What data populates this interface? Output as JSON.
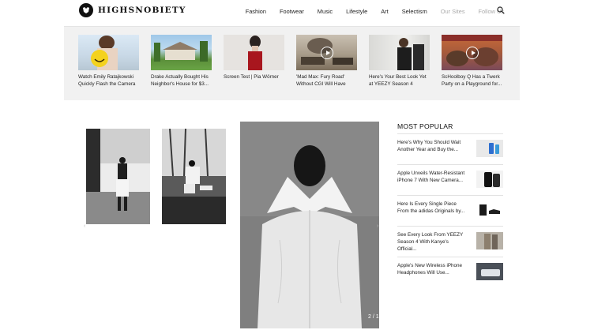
{
  "brand": {
    "name": "HIGHSNOBIETY"
  },
  "nav": [
    {
      "label": "Fashion",
      "muted": false
    },
    {
      "label": "Footwear",
      "muted": false
    },
    {
      "label": "Music",
      "muted": false
    },
    {
      "label": "Lifestyle",
      "muted": false
    },
    {
      "label": "Art",
      "muted": false
    },
    {
      "label": "Selectism",
      "muted": false
    },
    {
      "label": "Our Sites",
      "muted": true
    },
    {
      "label": "Follow Us",
      "muted": true
    }
  ],
  "trending": [
    {
      "title": "Watch Emily Ratajkowski Quickly Flash the Camera",
      "video": false
    },
    {
      "title": "Drake Actually Bought His Neighbor's House for $3...",
      "video": false
    },
    {
      "title": "Screen Test | Pia Wörner",
      "video": false
    },
    {
      "title": "'Mad Max: Fury Road' Without CGI Will Have",
      "video": true
    },
    {
      "title": "Here's Your Best Look Yet at YEEZY Season 4",
      "video": false
    },
    {
      "title": "ScHoolboy Q Has a Twerk Party on a Playground for...",
      "video": true
    }
  ],
  "gallery": {
    "counter": "2 / 1",
    "prev_arrow": "‹",
    "next_arrow": "›"
  },
  "most_popular": {
    "title": "MOST POPULAR",
    "items": [
      {
        "text": "Here's Why You Should Wait Another Year and Buy the..."
      },
      {
        "text": "Apple Unveils Water-Resistant iPhone 7 With New Camera..."
      },
      {
        "text": "Here Is Every Single Piece From the adidas Originals by..."
      },
      {
        "text": "See Every Look From YEEZY Season 4 With Kanye's Official..."
      },
      {
        "text": "Apple's New Wireless iPhone Headphones Will Use..."
      }
    ]
  },
  "colors": {
    "strip_bg": "#f1f1f1",
    "muted_nav": "#aaaaaa",
    "text": "#111111"
  }
}
